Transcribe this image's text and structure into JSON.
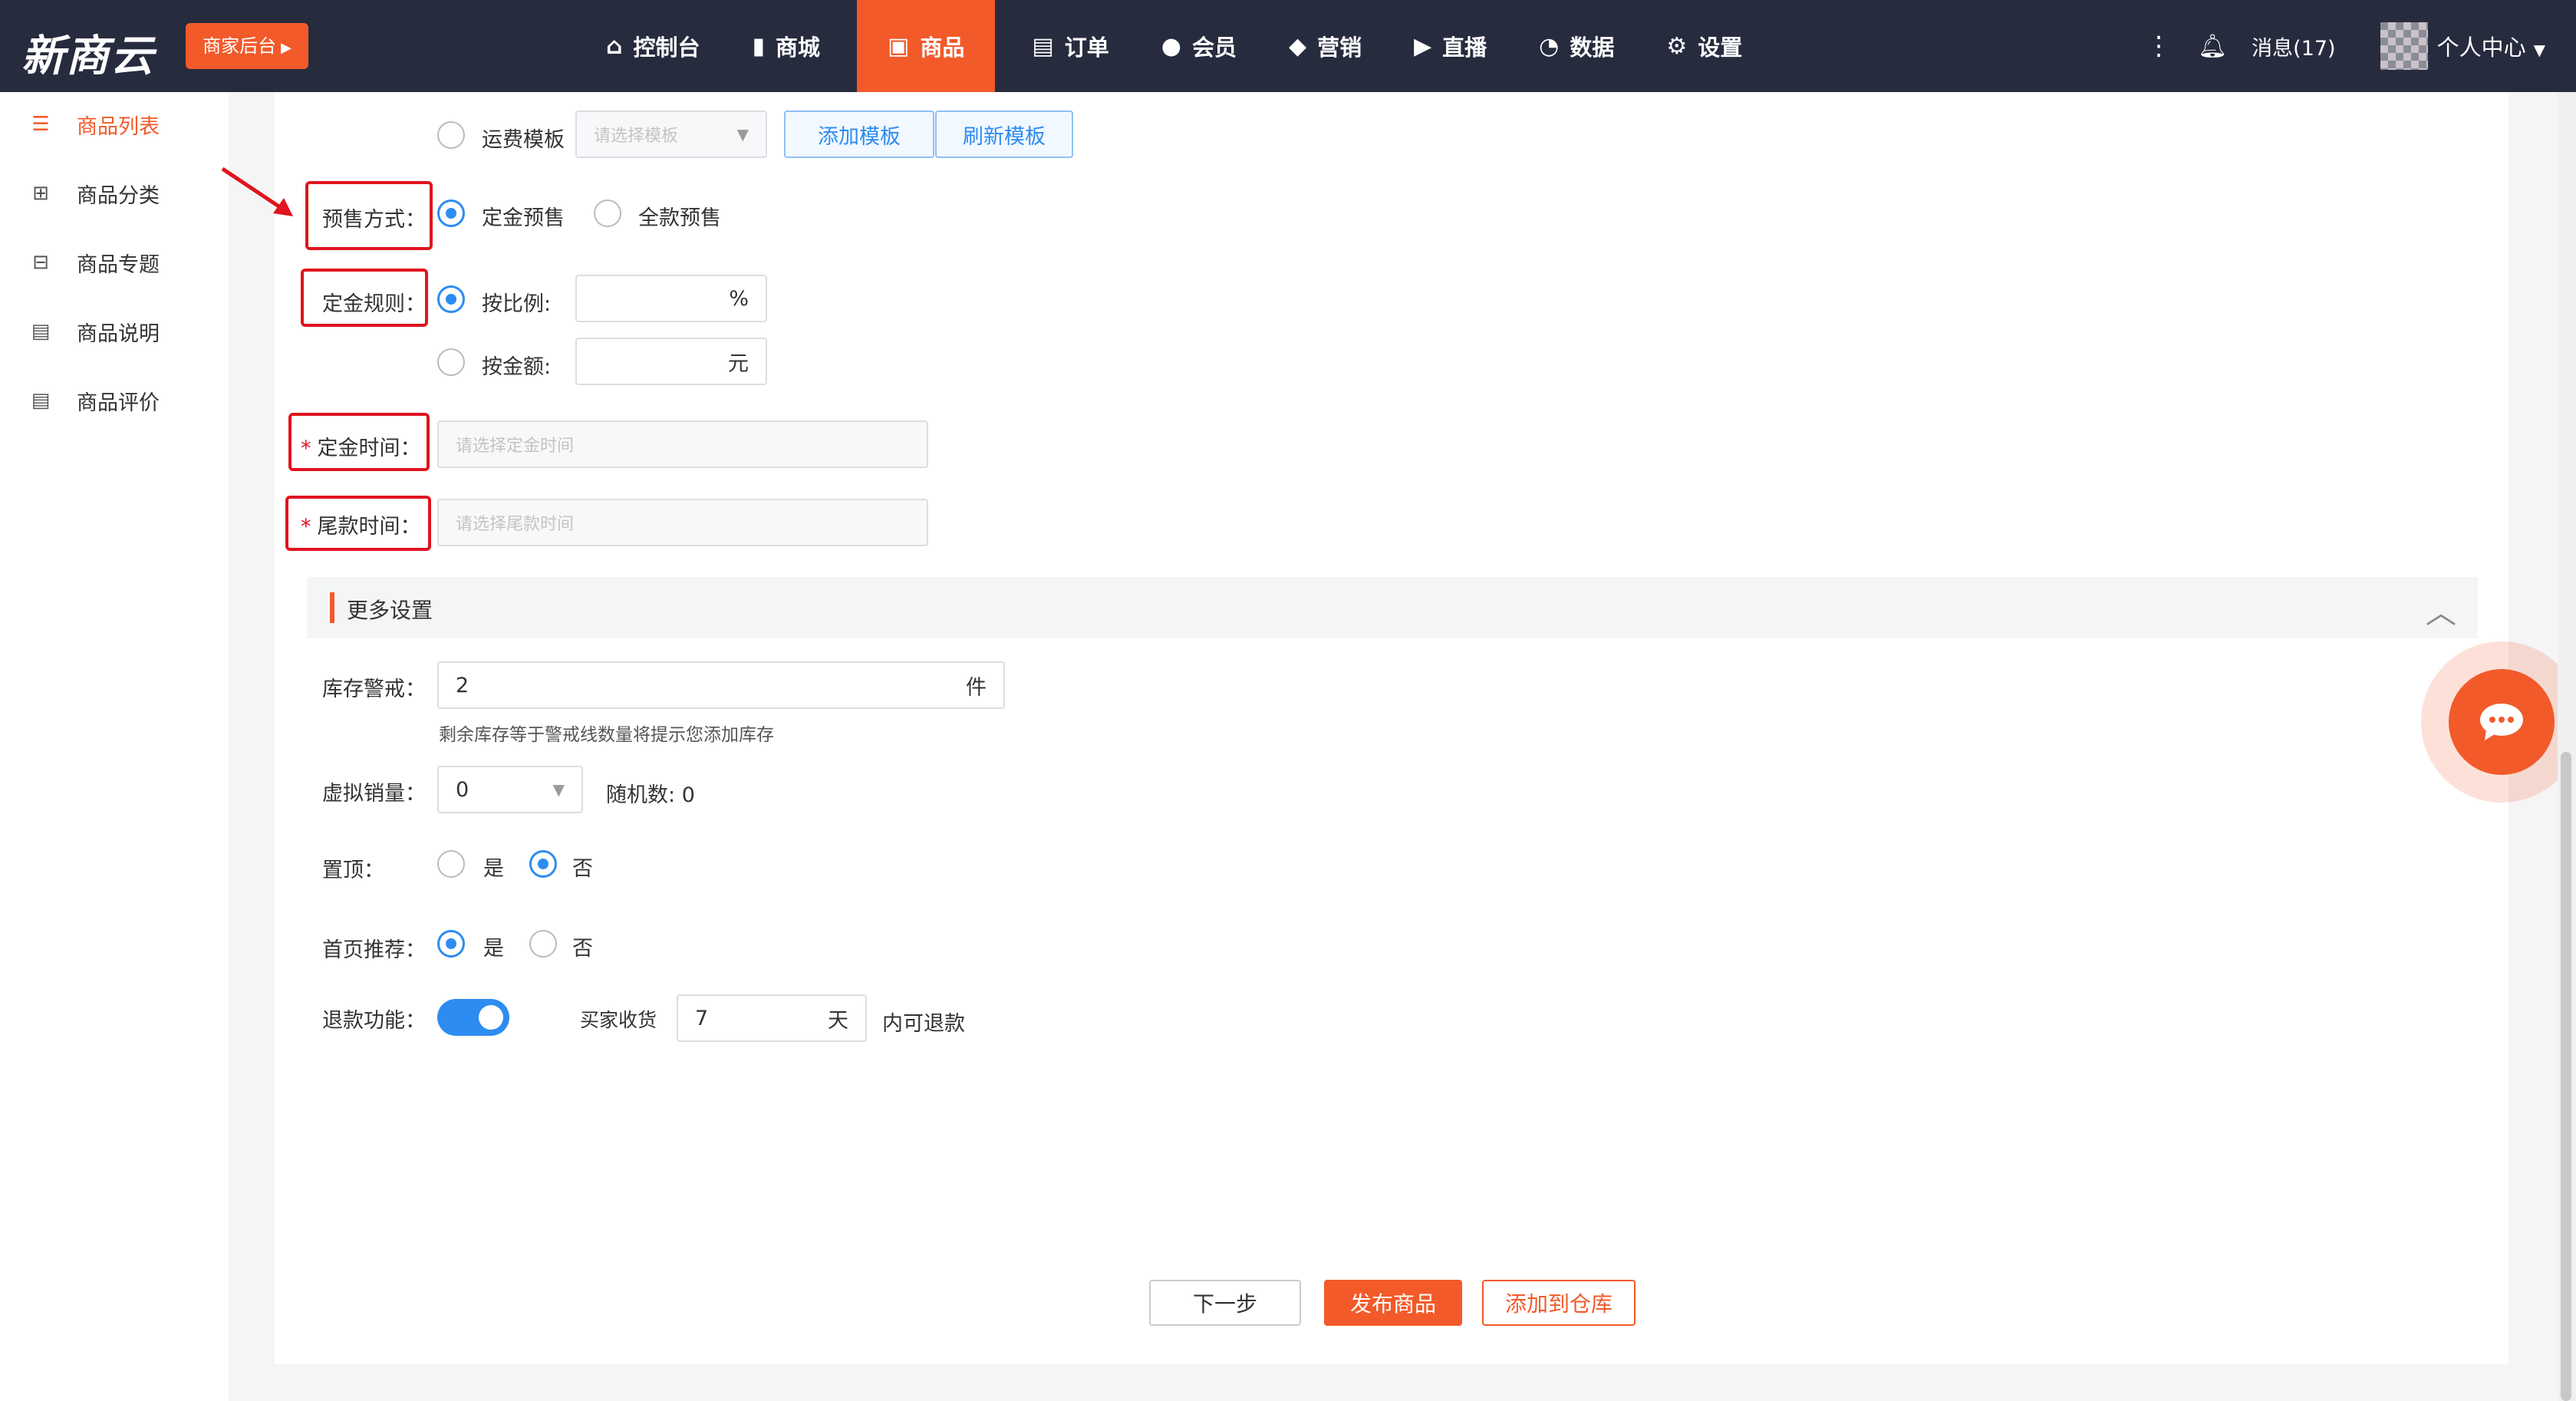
{
  "header": {
    "logo": "新商云",
    "merchant_button": "商家后台",
    "nav": [
      {
        "label": "控制台",
        "icon": "home-icon",
        "glyph": "⌂"
      },
      {
        "label": "商城",
        "icon": "building-icon",
        "glyph": "▮"
      },
      {
        "label": "商品",
        "icon": "shopping-bag-icon",
        "glyph": "▣"
      },
      {
        "label": "订单",
        "icon": "document-icon",
        "glyph": "▤"
      },
      {
        "label": "会员",
        "icon": "person-icon",
        "glyph": "●"
      },
      {
        "label": "营销",
        "icon": "cube-icon",
        "glyph": "◆"
      },
      {
        "label": "直播",
        "icon": "video-icon",
        "glyph": "▶"
      },
      {
        "label": "数据",
        "icon": "pie-chart-icon",
        "glyph": "◔"
      },
      {
        "label": "设置",
        "icon": "gear-icon",
        "glyph": "⚙"
      }
    ],
    "active_nav": "商品",
    "messages": "消息(17)",
    "user_center": "个人中心"
  },
  "sidebar": {
    "items": [
      {
        "label": "商品列表",
        "icon": "list-icon",
        "glyph": "☰"
      },
      {
        "label": "商品分类",
        "icon": "grid-icon",
        "glyph": "⊞"
      },
      {
        "label": "商品专题",
        "icon": "bag-icon",
        "glyph": "⊟"
      },
      {
        "label": "商品说明",
        "icon": "note-icon",
        "glyph": "▤"
      },
      {
        "label": "商品评价",
        "icon": "review-icon",
        "glyph": "▤"
      }
    ],
    "active": "商品列表"
  },
  "form": {
    "freight": {
      "radio_label": "运费模板",
      "select_placeholder": "请选择模板",
      "add_button": "添加模板",
      "refresh_button": "刷新模板"
    },
    "presale_mode": {
      "label": "预售方式：",
      "options": [
        "定金预售",
        "全款预售"
      ],
      "selected": "定金预售"
    },
    "deposit_rule": {
      "label": "定金规则：",
      "by_ratio_label": "按比例:",
      "ratio_unit": "%",
      "ratio_value": "",
      "by_amount_label": "按金额:",
      "amount_unit": "元",
      "amount_value": "",
      "selected": "按比例"
    },
    "deposit_time": {
      "required_mark": "*",
      "label": "定金时间：",
      "placeholder": "请选择定金时间"
    },
    "balance_time": {
      "required_mark": "*",
      "label": "尾款时间：",
      "placeholder": "请选择尾款时间"
    },
    "more_settings": {
      "title": "更多设置",
      "expanded": true
    },
    "stock_warning": {
      "label": "库存警戒：",
      "value": "2",
      "unit": "件",
      "help": "剩余库存等于警戒线数量将提示您添加库存"
    },
    "virtual_sales": {
      "label": "虚拟销量：",
      "value": "0",
      "random_label": "随机数:",
      "random_value": "0"
    },
    "pin_top": {
      "label": "置顶：",
      "options": [
        "是",
        "否"
      ],
      "selected": "否"
    },
    "home_recommend": {
      "label": "首页推荐：",
      "options": [
        "是",
        "否"
      ],
      "selected": "是"
    },
    "refund": {
      "label": "退款功能：",
      "enabled": true,
      "buyer_receive_label": "买家收货",
      "days_value": "7",
      "days_unit": "天",
      "suffix": "内可退款"
    }
  },
  "actions": {
    "next": "下一步",
    "publish": "发布商品",
    "add_to_warehouse": "添加到仓库"
  },
  "colors": {
    "brand": "#f25a2a",
    "topbar": "#272b3e",
    "primary_blue": "#2d8cf0",
    "annotation_red": "#e0141e"
  }
}
